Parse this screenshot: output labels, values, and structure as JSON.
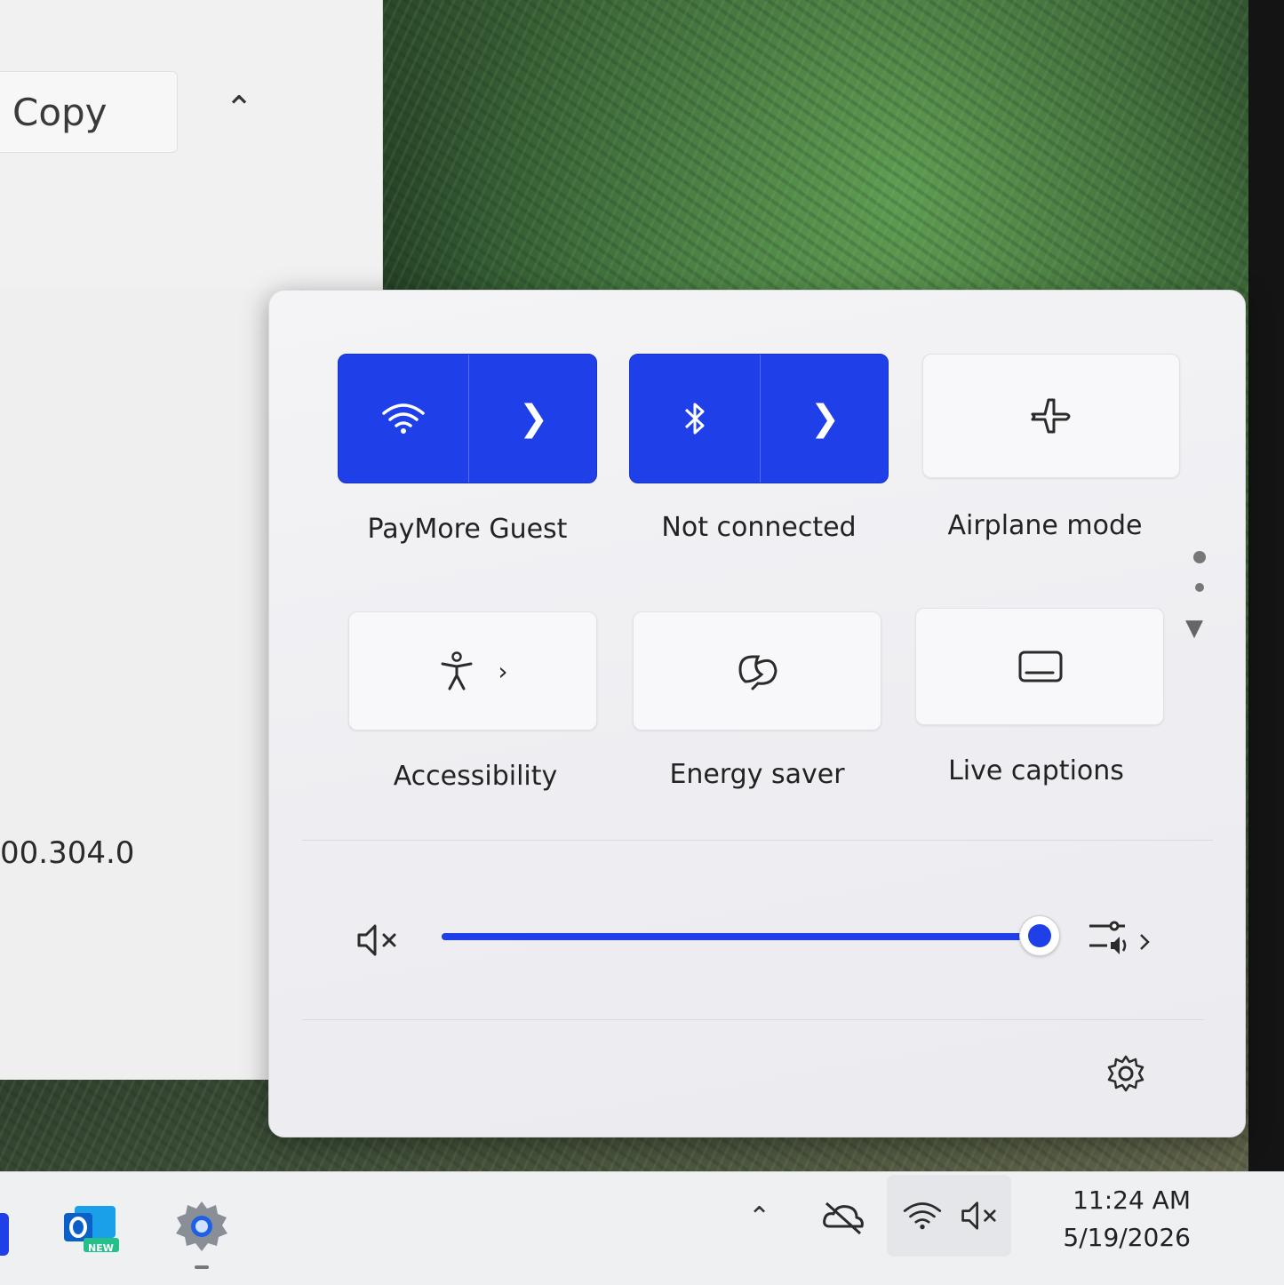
{
  "background_window": {
    "copy_label": "Copy",
    "version_text": "00.304.0"
  },
  "quick_settings": {
    "tiles": [
      {
        "label": "PayMore Guest",
        "icon": "wifi-icon",
        "state": "on"
      },
      {
        "label": "Not connected",
        "icon": "bluetooth-icon",
        "state": "on"
      },
      {
        "label": "Airplane mode",
        "icon": "airplane-icon",
        "state": "off"
      },
      {
        "label": "Accessibility",
        "icon": "accessibility-icon",
        "state": "off"
      },
      {
        "label": "Energy saver",
        "icon": "energy-saver-icon",
        "state": "off"
      },
      {
        "label": "Live captions",
        "icon": "live-captions-icon",
        "state": "off"
      }
    ],
    "volume": {
      "muted": true,
      "level_percent": 100
    },
    "accent_color": "#1f3fe8"
  },
  "taskbar": {
    "apps": [
      "outlook-new-icon",
      "settings-app-icon"
    ],
    "outlook_badge": "NEW",
    "tray_icons": [
      "show-hidden-icons-caret",
      "onedrive-offline-icon",
      "wifi-icon",
      "volume-muted-icon"
    ],
    "time": "11:24 AM",
    "date": "5/19/2026"
  }
}
